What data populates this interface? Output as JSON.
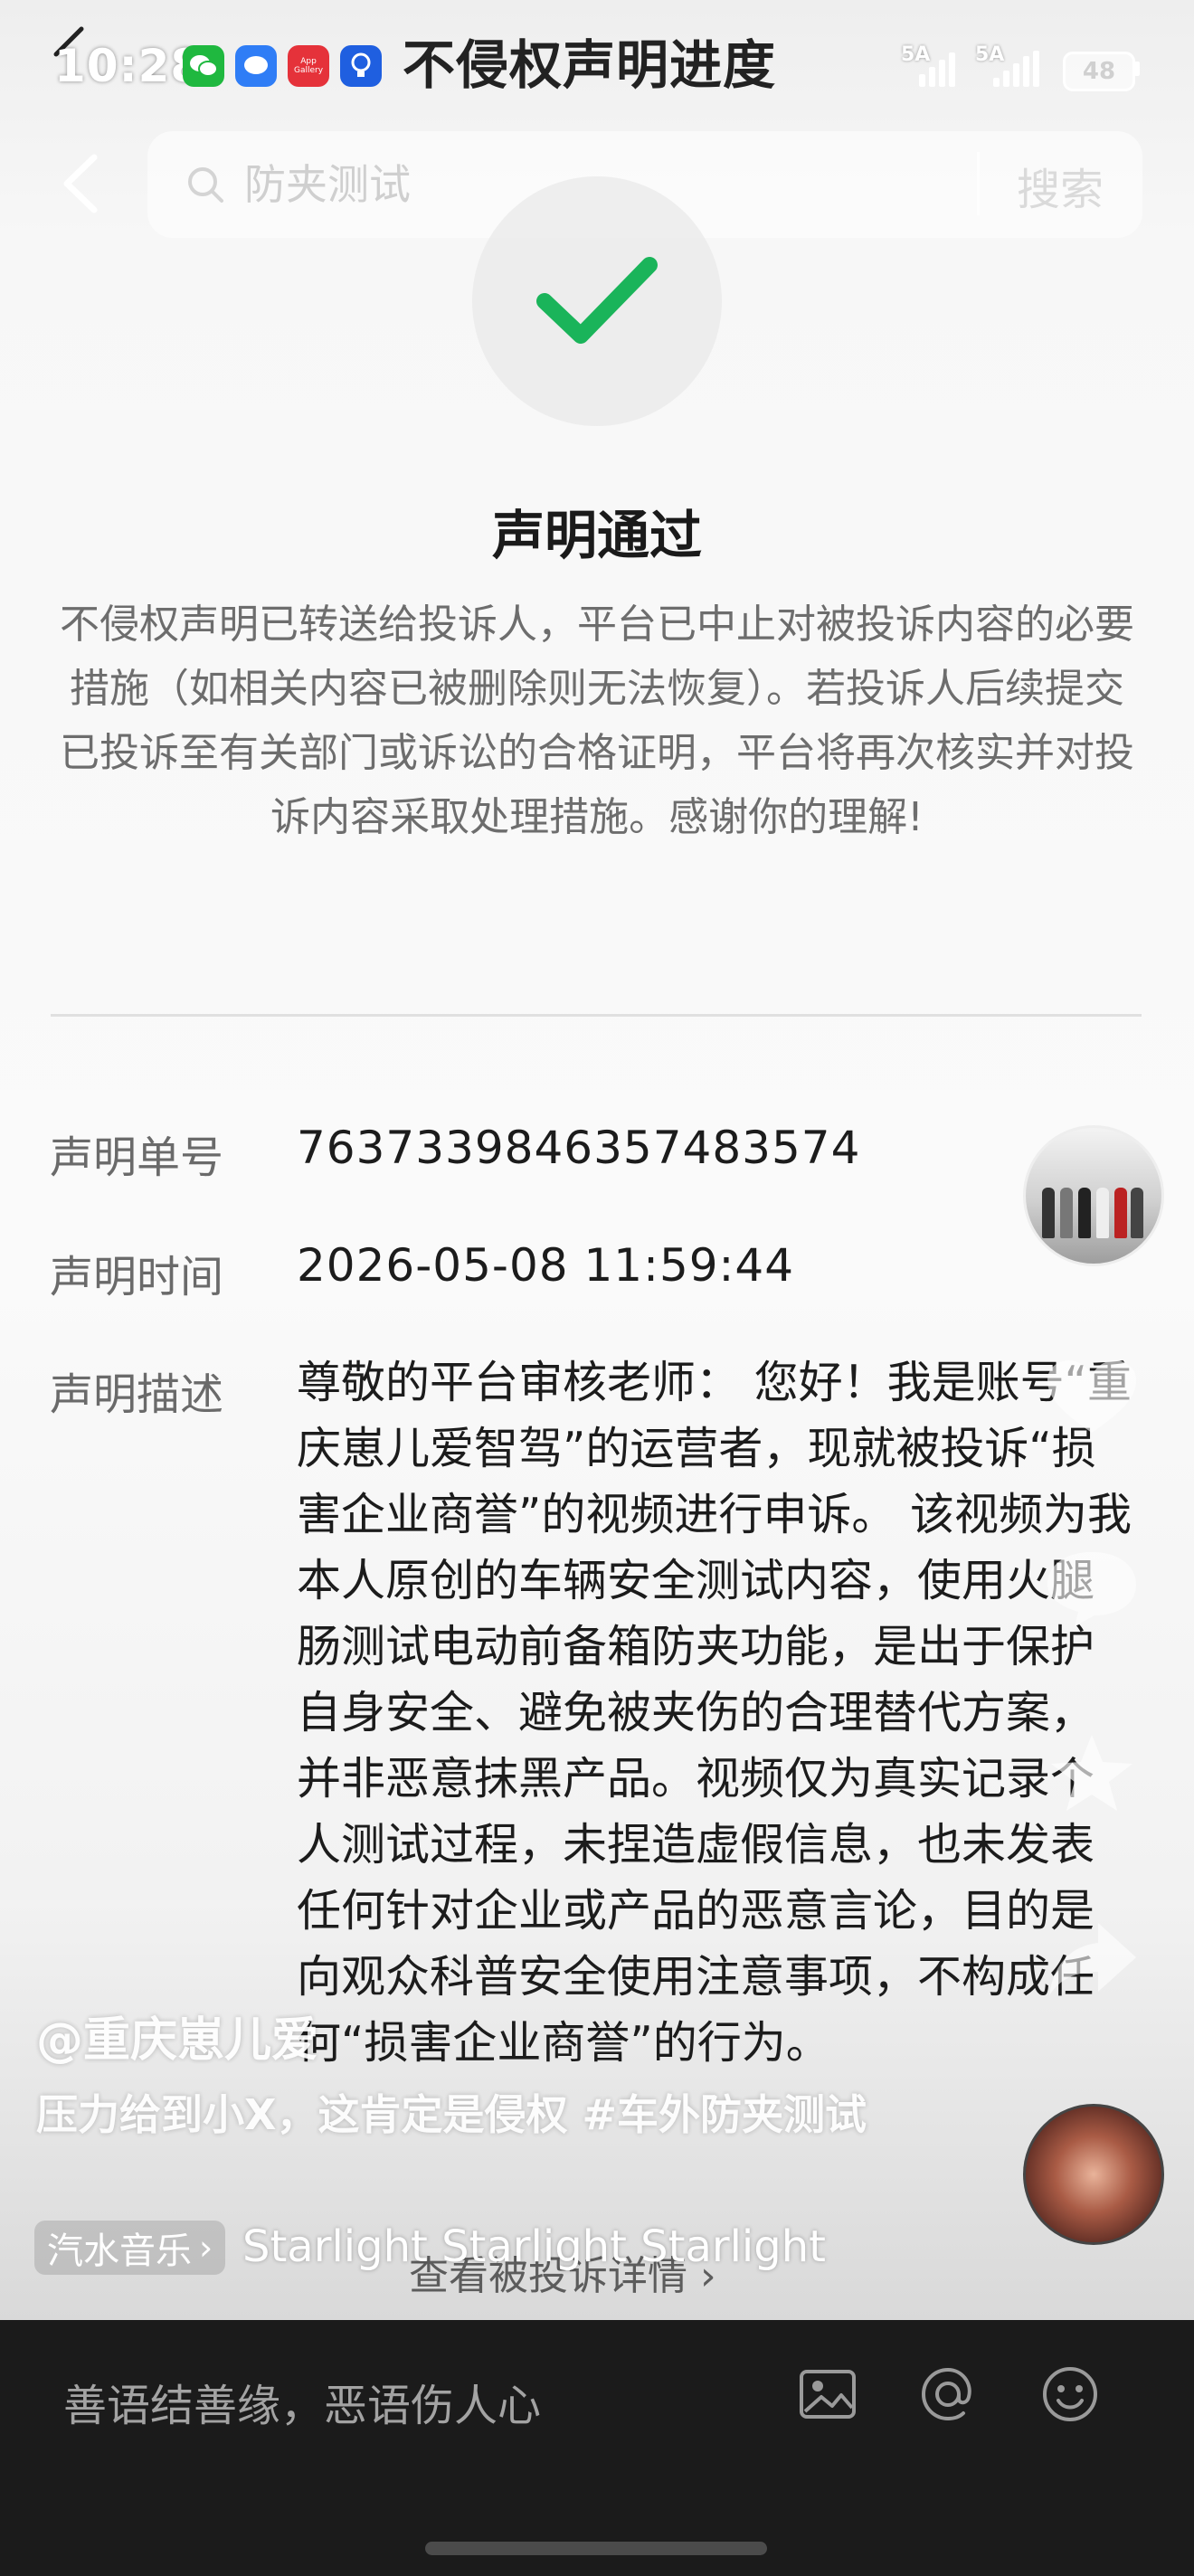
{
  "status_bar": {
    "time": "10:28",
    "signal1_label": "5A",
    "signal2_label": "5A",
    "battery": "48",
    "apps": [
      {
        "name": "wechat-icon",
        "color": "#22c55e"
      },
      {
        "name": "message-icon",
        "color": "#3b82f6"
      },
      {
        "name": "app-gallery-icon",
        "color": "#ef4444",
        "label": "App Gallery"
      },
      {
        "name": "bulb-icon",
        "color": "#2563eb"
      }
    ]
  },
  "header": {
    "title": "不侵权声明进度"
  },
  "search": {
    "placeholder": "防夹测试",
    "button_label": "搜索"
  },
  "result": {
    "title": "声明通过",
    "description": "不侵权声明已转送给投诉人，平台已中止对被投诉内容的必要措施（如相关内容已被删除则无法恢复）。若投诉人后续提交已投诉至有关部门或诉讼的合格证明，平台将再次核实并对投诉内容采取处理措施。感谢你的理解!",
    "accent_color": "#1db954"
  },
  "details": {
    "number_label": "声明单号",
    "number_value": "7637339846357483574",
    "time_label": "声明时间",
    "time_value": "2026-05-08 11:59:44",
    "desc_label": "声明描述",
    "desc_value": "尊敬的平台审核老师： 您好！我是账号“重庆崽儿爱智驾”的运营者，现就被投诉“损害企业商誉”的视频进行申诉。 该视频为我本人原创的车辆安全测试内容，使用火腿肠测试电动前备箱防夹功能，是出于保护自身安全、避免被夹伤的合理替代方案，并非恶意抹黑产品。视频仅为真实记录个人测试过程，未捏造虚假信息，也未发表任何针对企业或产品的恶意言论，目的是向观众科普安全使用注意事项，不构成任何“损害企业商誉”的行为。"
  },
  "footer_link": "查看被投诉详情 ›",
  "video_overlay": {
    "author": "@重庆崽儿爱",
    "caption_text": "压力给到小X，这肯定是侵权 ",
    "caption_tag": "#车外防夹测试",
    "music_chip": "汽水音乐",
    "music_title": "Starlight  Starlight  Starlight"
  },
  "comment_bar": {
    "placeholder": "善语结善缘，恶语伤人心"
  }
}
